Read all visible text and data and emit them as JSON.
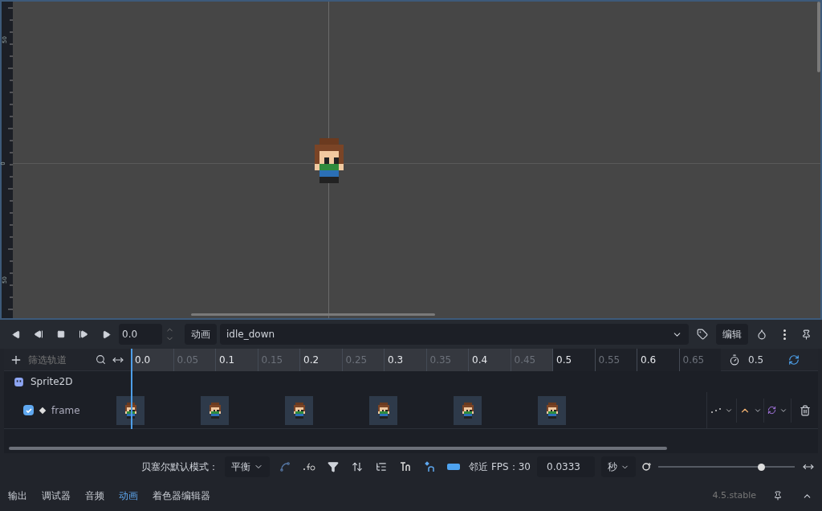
{
  "viewport": {
    "ruler_labels": [
      "50",
      "0",
      "50"
    ]
  },
  "animation_toolbar": {
    "time": "0.0",
    "animation_label": "动画",
    "animation": "idle_down",
    "edit_button": "编辑"
  },
  "timeline": {
    "filter_placeholder": "筛选轨道",
    "length": "0.5",
    "loop": true,
    "ticks": [
      {
        "label": "0.0",
        "major": true,
        "in_range": true,
        "has_key": true
      },
      {
        "label": "0.05",
        "major": false,
        "in_range": true,
        "has_key": false
      },
      {
        "label": "0.1",
        "major": true,
        "in_range": true,
        "has_key": true
      },
      {
        "label": "0.15",
        "major": false,
        "in_range": true,
        "has_key": false
      },
      {
        "label": "0.2",
        "major": true,
        "in_range": true,
        "has_key": true
      },
      {
        "label": "0.25",
        "major": false,
        "in_range": true,
        "has_key": false
      },
      {
        "label": "0.3",
        "major": true,
        "in_range": true,
        "has_key": true
      },
      {
        "label": "0.35",
        "major": false,
        "in_range": true,
        "has_key": false
      },
      {
        "label": "0.4",
        "major": true,
        "in_range": true,
        "has_key": true
      },
      {
        "label": "0.45",
        "major": false,
        "in_range": true,
        "has_key": false
      },
      {
        "label": "0.5",
        "major": true,
        "in_range": false,
        "has_key": true
      },
      {
        "label": "0.55",
        "major": false,
        "in_range": false,
        "has_key": false
      },
      {
        "label": "0.6",
        "major": true,
        "in_range": false,
        "has_key": false
      },
      {
        "label": "0.65",
        "major": false,
        "in_range": false,
        "has_key": false
      }
    ],
    "node": "Sprite2D",
    "tracks": [
      {
        "name": "frame",
        "checked": true
      }
    ]
  },
  "bottom_toolbar": {
    "bezier_label": "贝塞尔默认模式：",
    "bezier_mode": "平衡",
    "fps_label": "邻近 FPS：30",
    "step": "0.0333",
    "unit": "秒",
    "zoom": {
      "level": 0.75
    }
  },
  "dock": {
    "tabs": [
      {
        "label": "输出",
        "selected": false
      },
      {
        "label": "调试器",
        "selected": false
      },
      {
        "label": "音频",
        "selected": false
      },
      {
        "label": "动画",
        "selected": true
      },
      {
        "label": "着色器编辑器",
        "selected": false
      }
    ],
    "version": "4.5.stable"
  }
}
